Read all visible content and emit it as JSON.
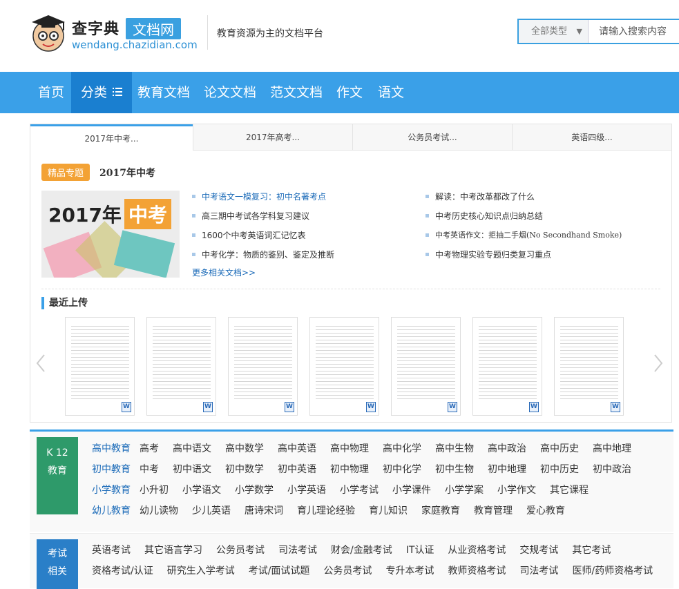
{
  "header": {
    "logo_cn": "查字典",
    "logo_cn2": "文档网",
    "logo_en": "wendang.chazidian.com",
    "slogan": "教育资源为主的文档平台",
    "search_type": "全部类型",
    "search_placeholder": "请输入搜索内容"
  },
  "nav": {
    "items": [
      "首页",
      "分类",
      "教育文档",
      "论文文档",
      "范文文档",
      "作文",
      "语文"
    ]
  },
  "topics": {
    "tabs": [
      "2017年中考...",
      "2017年高考...",
      "公务员考试...",
      "英语四级..."
    ],
    "badge": "精品专题",
    "title": "2017年中考",
    "cover_text": "2017年",
    "cover_highlight": "中考",
    "links_left": [
      "中考语文一模复习：初中名著考点",
      "高三期中考试各学科复习建议",
      "1600个中考英语词汇记忆表",
      "中考化学：物质的鉴别、鉴定及推断"
    ],
    "links_right": [
      "解读：中考改革都改了什么",
      "中考历史核心知识点归纳总结",
      "中考英语作文：拒抽二手烟(No Secondhand Smoke)",
      "中考物理实验专题归类复习重点"
    ],
    "more": "更多相关文档>>"
  },
  "recent": {
    "title": "最近上传",
    "thumb_icon": "W"
  },
  "k12": {
    "label_line1": "K 12",
    "label_line2": "教育",
    "rows": [
      {
        "head": "高中教育",
        "items": [
          "高考",
          "高中语文",
          "高中数学",
          "高中英语",
          "高中物理",
          "高中化学",
          "高中生物",
          "高中政治",
          "高中历史",
          "高中地理"
        ]
      },
      {
        "head": "初中教育",
        "items": [
          "中考",
          "初中语文",
          "初中数学",
          "初中英语",
          "初中物理",
          "初中化学",
          "初中生物",
          "初中地理",
          "初中历史",
          "初中政治"
        ]
      },
      {
        "head": "小学教育",
        "items": [
          "小升初",
          "小学语文",
          "小学数学",
          "小学英语",
          "小学考试",
          "小学课件",
          "小学学案",
          "小学作文",
          "其它课程"
        ]
      },
      {
        "head": "幼儿教育",
        "items": [
          "幼儿读物",
          "少儿英语",
          "唐诗宋词",
          "育儿理论经验",
          "育儿知识",
          "家庭教育",
          "教育管理",
          "爱心教育"
        ]
      }
    ]
  },
  "exam": {
    "label_line1": "考试",
    "label_line2": "相关",
    "rows": [
      {
        "items": [
          "英语考试",
          "其它语言学习",
          "公务员考试",
          "司法考试",
          "财会/金融考试",
          "IT认证",
          "从业资格考试",
          "交规考试",
          "其它考试"
        ]
      },
      {
        "items": [
          "资格考试/认证",
          "研究生入学考试",
          "考试/面试试题",
          "公务员考试",
          "专升本考试",
          "教师资格考试",
          "司法考试",
          "医师/药师资格考试"
        ]
      }
    ]
  }
}
